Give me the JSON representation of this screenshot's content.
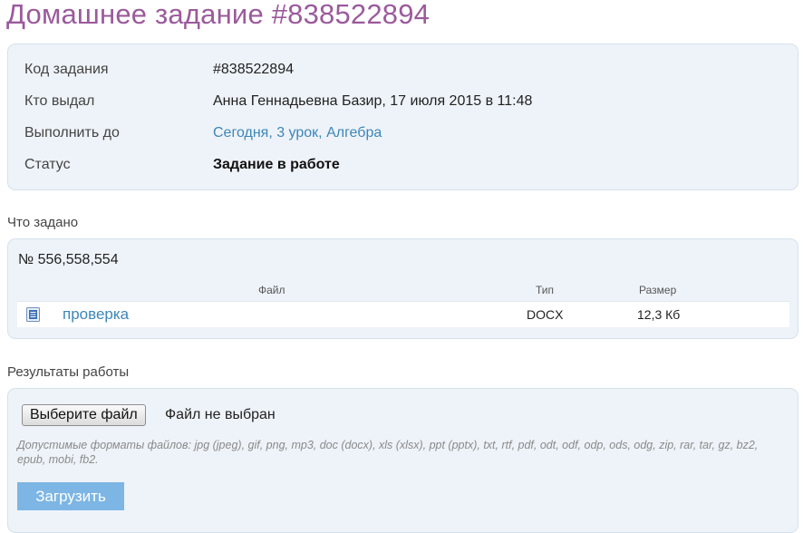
{
  "page": {
    "title": "Домашнее задание #838522894"
  },
  "info": {
    "rows": [
      {
        "label": "Код задания",
        "value": "#838522894"
      },
      {
        "label": "Кто выдал",
        "value": "Анна Геннадьевна Базир, 17 июля 2015 в 11:48"
      },
      {
        "label": "Выполнить до",
        "value": "Сегодня, 3 урок, Алгебра"
      },
      {
        "label": "Статус",
        "value": "Задание в работе"
      }
    ]
  },
  "task": {
    "section_title": "Что задано",
    "number": "№ 556,558,554",
    "columns": {
      "file": "Файл",
      "type": "Тип",
      "size": "Размер"
    },
    "files": [
      {
        "name": "проверка",
        "type": "DOCX",
        "size": "12,3 Кб",
        "icon": "docx-file-icon"
      }
    ]
  },
  "results": {
    "section_title": "Результаты работы",
    "choose_button": "Выберите файл",
    "no_file_text": "Файл не выбран",
    "formats_text": "Допустимые форматы файлов: jpg (jpeg), gif, png, mp3, doc (docx), xls (xlsx), ppt (pptx), txt, rtf, pdf, odt, odf, odp, ods, odg, zip, rar, tar, gz, bz2, epub, mobi, fb2.",
    "upload_button": "Загрузить"
  },
  "colors": {
    "title": "#9b5a9c",
    "link": "#3d86b8",
    "panel_bg": "#eef3f9",
    "upload_button": "#7db6e4"
  }
}
